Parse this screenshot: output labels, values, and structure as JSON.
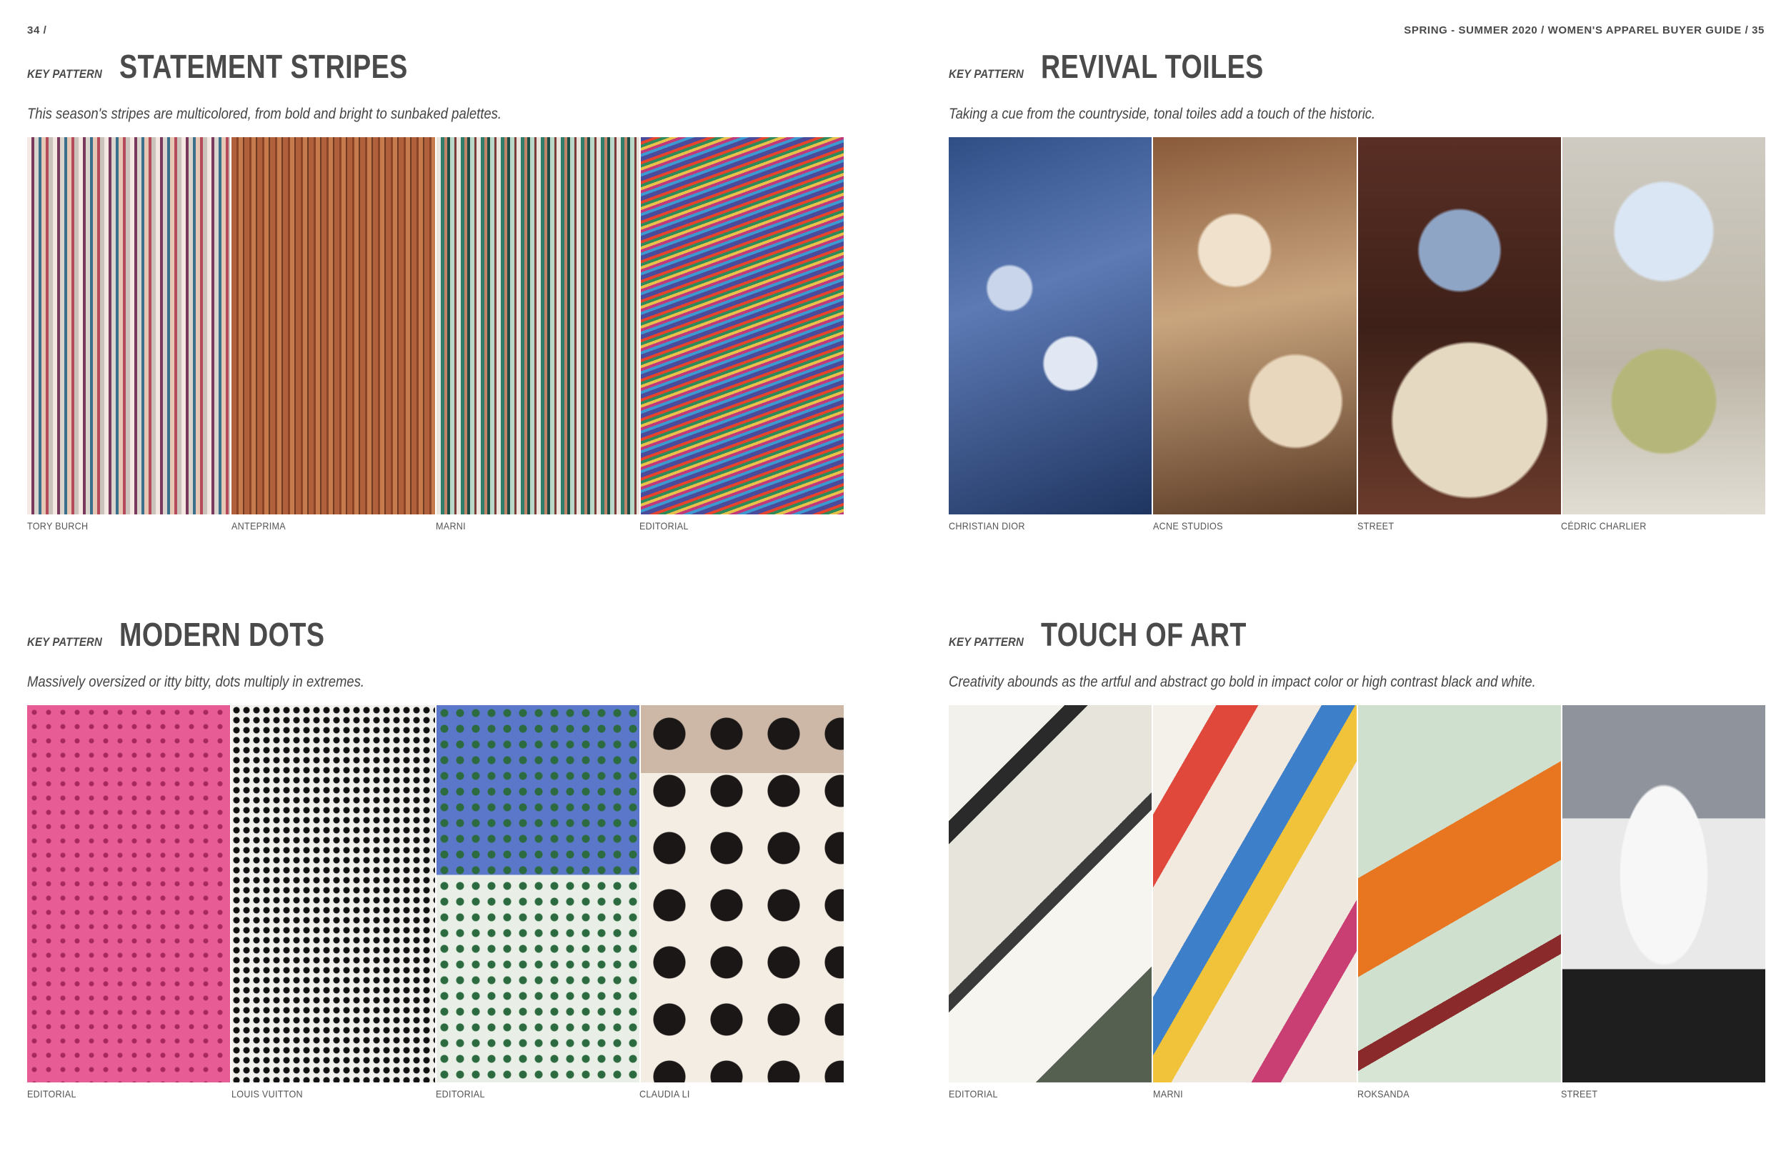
{
  "folio": {
    "left": "34 /",
    "right": "SPRING - SUMMER 2020 / WOMEN'S APPAREL BUYER GUIDE /  35"
  },
  "sections": [
    {
      "kicker": "KEY PATTERN",
      "title": "STATEMENT STRIPES",
      "subtitle": "This season's stripes are multicolored, from bold and bright to sunbaked palettes.",
      "captions": [
        "TORY BURCH",
        "ANTEPRIMA",
        "MARNI",
        "EDITORIAL"
      ]
    },
    {
      "kicker": "KEY PATTERN",
      "title": "REVIVAL TOILES",
      "subtitle": "Taking a cue from the countryside, tonal toiles add a touch of the historic.",
      "captions": [
        "CHRISTIAN DIOR",
        "ACNE STUDIOS",
        "STREET",
        "CÉDRIC CHARLIER"
      ]
    },
    {
      "kicker": "KEY PATTERN",
      "title": "MODERN DOTS",
      "subtitle": "Massively oversized or itty bitty, dots multiply in extremes.",
      "captions": [
        "EDITORIAL",
        "LOUIS VUITTON",
        "EDITORIAL",
        "CLAUDIA LI"
      ]
    },
    {
      "kicker": "KEY PATTERN",
      "title": "TOUCH OF ART",
      "subtitle": "Creativity abounds as the artful and abstract go bold in impact color or high contrast black and white.",
      "captions": [
        "EDITORIAL",
        "MARNI",
        "ROKSANDA",
        "STREET"
      ]
    }
  ]
}
